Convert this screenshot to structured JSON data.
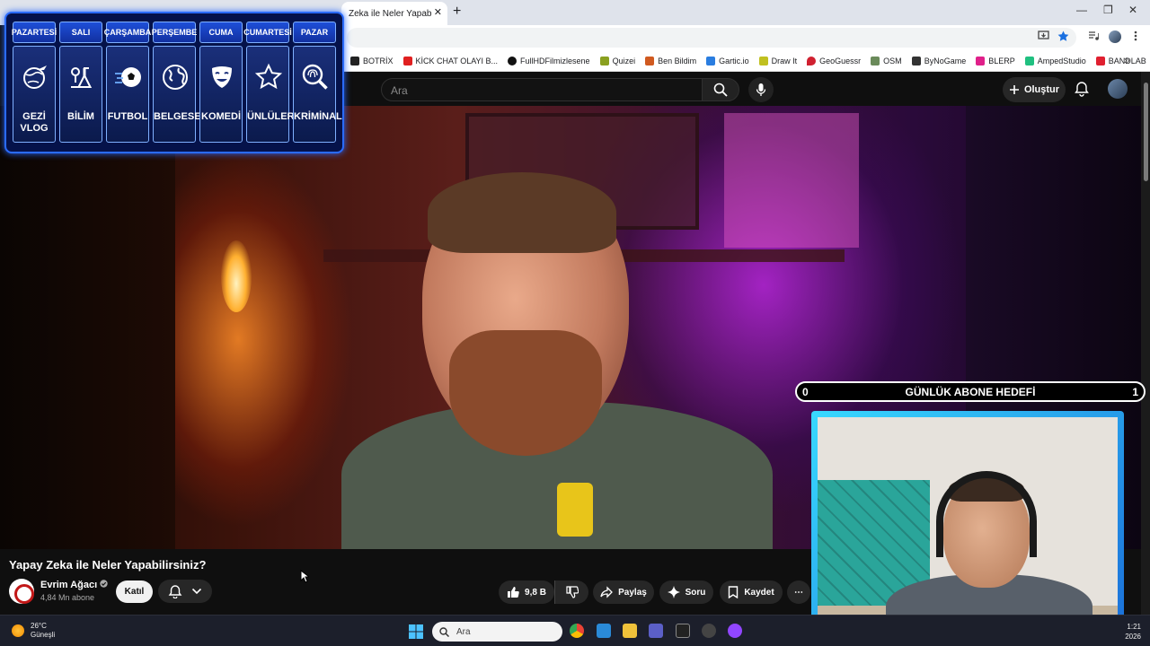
{
  "browser": {
    "tab_title": "Zeka ile Neler Yapabilirsi",
    "tab_close": "✕",
    "new_tab": "+",
    "window_controls": [
      "—",
      "❐",
      "✕"
    ],
    "bookmarks": [
      {
        "label": "BOTRİX",
        "color": "#222222"
      },
      {
        "label": "KİCK CHAT OLAYI B...",
        "color": "#e02020"
      },
      {
        "label": "FullHDFilmizlesene",
        "color": "#111111"
      },
      {
        "label": "Quizei",
        "color": "#8aa020"
      },
      {
        "label": "Ben Bildim",
        "color": "#d05a20"
      },
      {
        "label": "Gartic.io",
        "color": "#2a7de0"
      },
      {
        "label": "Draw It",
        "color": "#c0c020"
      },
      {
        "label": "GeoGuessr",
        "color": "#d02030"
      },
      {
        "label": "OSM",
        "color": "#6a8a5a"
      },
      {
        "label": "ByNoGame",
        "color": "#333333"
      },
      {
        "label": "BLERP",
        "color": "#e0208a"
      },
      {
        "label": "AmpedStudio",
        "color": "#20c080"
      },
      {
        "label": "BANDLAB",
        "color": "#e02030"
      }
    ],
    "bookmarks_more": "»"
  },
  "youtube": {
    "search_placeholder": "Ara",
    "create_label": "Oluştur",
    "video_title": "Yapay Zeka ile Neler Yapabilirsiniz?",
    "channel_name": "Evrim Ağacı",
    "channel_subs": "4,84 Mn abone",
    "join_label": "Katıl",
    "like_count": "9,8 B",
    "share_label": "Paylaş",
    "ask_label": "Soru",
    "save_label": "Kaydet",
    "more_label": "⋯"
  },
  "schedule": {
    "days": [
      {
        "day": "PAZARTESİ",
        "label": "GEZİ VLOG",
        "icon": "globe-plane-icon"
      },
      {
        "day": "SALI",
        "label": "BİLİM",
        "icon": "science-icon"
      },
      {
        "day": "ÇARŞAMBA",
        "label": "FUTBOL",
        "icon": "soccer-ball-icon"
      },
      {
        "day": "PERŞEMBE",
        "label": "BELGESEL",
        "icon": "earth-icon"
      },
      {
        "day": "CUMA",
        "label": "KOMEDİ",
        "icon": "comedy-mask-icon"
      },
      {
        "day": "CUMARTESİ",
        "label": "ÜNLÜLER",
        "icon": "star-icon"
      },
      {
        "day": "PAZAR",
        "label": "KRİMİNAL",
        "icon": "fingerprint-magnifier-icon"
      }
    ]
  },
  "goal": {
    "left": "0",
    "title": "GÜNLÜK ABONE HEDEFİ",
    "right": "1"
  },
  "taskbar": {
    "temperature": "26°C",
    "weather": "Güneşli",
    "search_placeholder": "Ara",
    "time": "1:21",
    "year": "2026"
  }
}
